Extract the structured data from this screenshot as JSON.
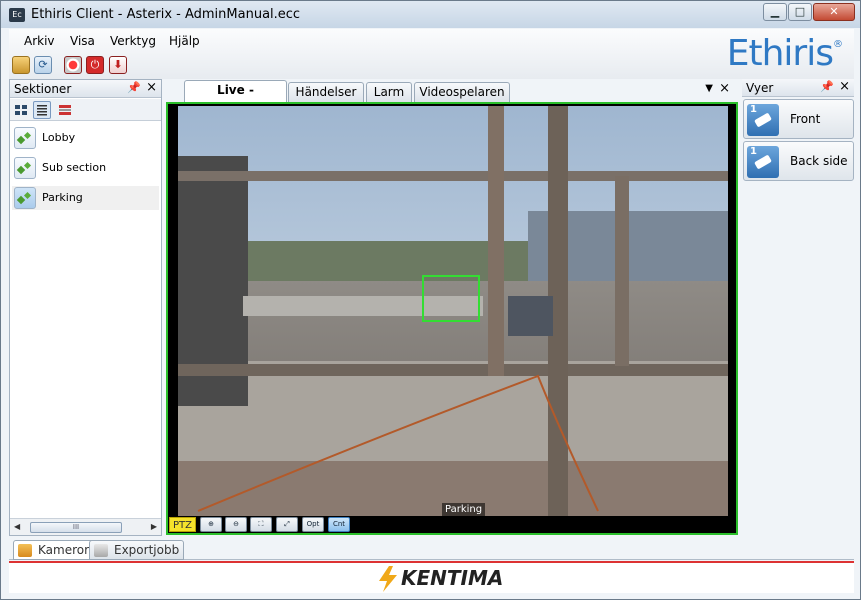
{
  "window": {
    "app_icon": "Ec",
    "title": "Ethiris Client - Asterix - AdminManual.ecc",
    "controls": [
      "minimize-icon",
      "maximize-icon",
      "close-icon"
    ]
  },
  "menu": {
    "items": [
      "Arkiv",
      "Visa",
      "Verktyg",
      "Hjälp"
    ]
  },
  "toolbar": {
    "buttons": [
      "folder-icon",
      "refresh-icon",
      "record-icon",
      "power-icon",
      "export-icon"
    ]
  },
  "brand": {
    "logo_text": "Ethiris",
    "logo_mark": "®",
    "color": "#2f79c4"
  },
  "sections_pane": {
    "title": "Sektioner",
    "pin": "pin-icon",
    "close": "×",
    "items": [
      {
        "label": "Lobby"
      },
      {
        "label": "Sub section"
      },
      {
        "label": "Parking"
      }
    ],
    "selected_index": 2,
    "scroll_grip": "III"
  },
  "center": {
    "tabs": [
      "Live - Dynamisk",
      "Händelser",
      "Larm",
      "Videospelaren"
    ],
    "active_tab": 0,
    "tab_menu": "▼",
    "tab_close": "×"
  },
  "video": {
    "camera_label": "Parking",
    "border_color": "#2bbf2b",
    "ptz": {
      "label": "PTZ",
      "buttons": [
        "zoom-in-icon",
        "zoom-out-icon",
        "fit-icon",
        "fullscreen-icon"
      ],
      "text_buttons": [
        "Opt",
        "Cnt"
      ],
      "active": "Cnt"
    }
  },
  "views_pane": {
    "title": "Vyer",
    "close": "×",
    "items": [
      {
        "number": "1",
        "label": "Front"
      },
      {
        "number": "1",
        "label": "Back side"
      }
    ]
  },
  "bottom_tabs": {
    "items": [
      "Kameror",
      "Exportjobb"
    ],
    "active_index": 0
  },
  "footer": {
    "brand": "KENTIMA",
    "accent": "#d33333"
  }
}
